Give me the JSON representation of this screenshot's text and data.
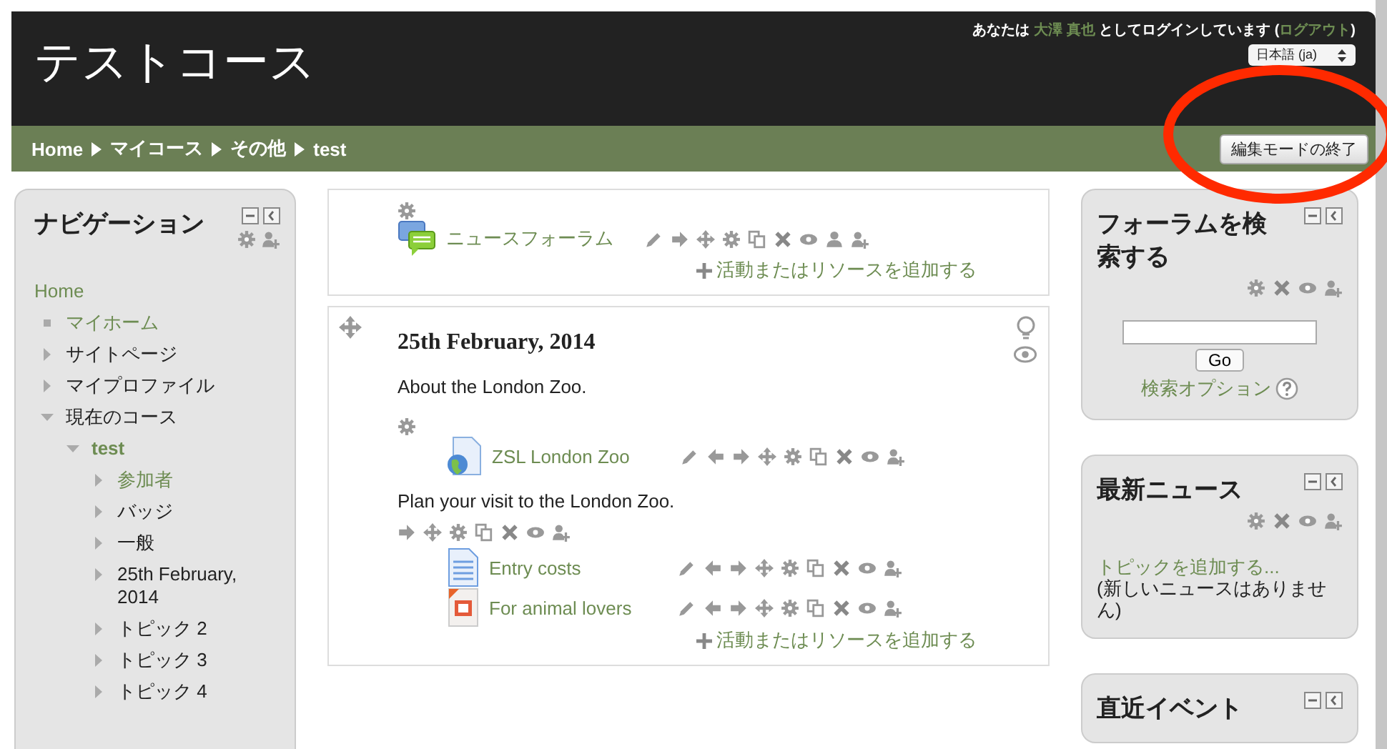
{
  "header": {
    "title": "テストコース",
    "login": {
      "prefix": "あなたは",
      "user": "大澤 真也",
      "middle": "としてログインしています (",
      "logout": "ログアウト",
      "suffix": ")"
    },
    "language": "日本語 (ja)"
  },
  "breadcrumb": [
    "Home",
    "マイコース",
    "その他",
    "test"
  ],
  "edit_button": "編集モードの終了",
  "navigation": {
    "title": "ナビゲーション",
    "home": "Home",
    "items": [
      {
        "label": "マイホーム",
        "kind": "leaf",
        "link": true
      },
      {
        "label": "サイトページ",
        "kind": "node",
        "expanded": false,
        "link": false
      },
      {
        "label": "マイプロファイル",
        "kind": "node",
        "expanded": false,
        "link": false
      },
      {
        "label": "現在のコース",
        "kind": "node",
        "expanded": true,
        "link": false,
        "children": [
          {
            "label": "test",
            "kind": "node",
            "expanded": true,
            "link": true,
            "children": [
              {
                "label": "参加者",
                "kind": "node",
                "expanded": false,
                "link": true
              },
              {
                "label": "バッジ",
                "kind": "node",
                "expanded": false,
                "link": false
              },
              {
                "label": "一般",
                "kind": "node",
                "expanded": false,
                "link": false
              },
              {
                "label": "25th February, 2014",
                "kind": "node",
                "expanded": false,
                "link": false
              },
              {
                "label": "トピック 2",
                "kind": "node",
                "expanded": false,
                "link": false
              },
              {
                "label": "トピック 3",
                "kind": "node",
                "expanded": false,
                "link": false
              },
              {
                "label": "トピック 4",
                "kind": "node",
                "expanded": false,
                "link": false
              }
            ]
          }
        ]
      }
    ]
  },
  "sections": [
    {
      "items": [
        {
          "kind": "forum",
          "name": "ニュースフォーラム"
        }
      ],
      "add": "活動またはリソースを追加する"
    },
    {
      "title": "25th February, 2014",
      "summary": "About the London Zoo.",
      "items": [
        {
          "kind": "url",
          "name": "ZSL London Zoo"
        },
        {
          "kind": "label",
          "name": "Plan your visit to the London Zoo."
        },
        {
          "kind": "page",
          "name": "Entry costs"
        },
        {
          "kind": "file",
          "name": "For animal lovers"
        }
      ],
      "add": "活動またはリソースを追加する"
    }
  ],
  "blocks": [
    {
      "kind": "search",
      "title": "フォーラムを検索する",
      "button": "Go",
      "options": "検索オプション"
    },
    {
      "kind": "news",
      "title": "最新ニュース",
      "link": "トピックを追加する...",
      "note": "(新しいニュースはありません)"
    },
    {
      "kind": "events",
      "title": "直近イベント"
    }
  ]
}
